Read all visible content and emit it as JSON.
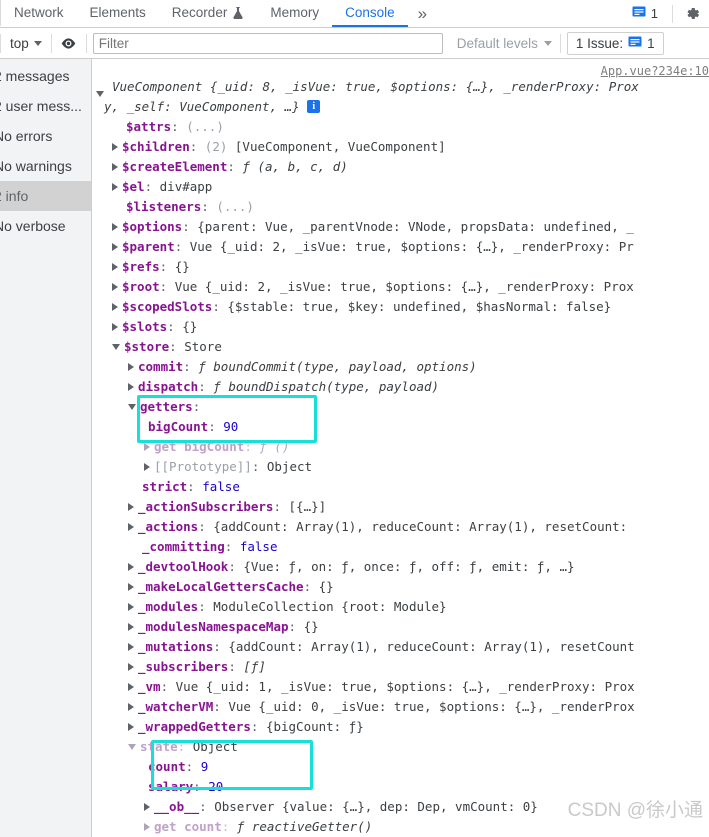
{
  "devtools": {
    "tabs": [
      {
        "label": "Network",
        "active": false,
        "icon": null
      },
      {
        "label": "Elements",
        "active": false,
        "icon": null
      },
      {
        "label": "Recorder",
        "active": false,
        "icon": "flask-icon"
      },
      {
        "label": "Memory",
        "active": false,
        "icon": null
      },
      {
        "label": "Console",
        "active": true,
        "icon": null
      }
    ],
    "more_label": "»",
    "message_badge_count": "1",
    "gear_icon": "gear-icon"
  },
  "toolbar": {
    "context": "top",
    "eye_icon": "eye-icon",
    "filter_placeholder": "Filter",
    "filter_value": "",
    "levels_label": "Default levels",
    "issues_label": "1 Issue:",
    "issues_count": "1"
  },
  "sidebar": {
    "items": [
      {
        "label": "2 messages",
        "selected": false
      },
      {
        "label": "2 user mess...",
        "selected": false
      },
      {
        "label": "No errors",
        "selected": false
      },
      {
        "label": "No warnings",
        "selected": false
      },
      {
        "label": "2 info",
        "selected": true
      },
      {
        "label": "No verbose",
        "selected": false
      }
    ]
  },
  "console": {
    "source_link": "App.vue?234e:10",
    "watermark": "CSDN @徐小通",
    "accent_highlight": "#17e0d8",
    "lines": {
      "root_a": "VueComponent {_uid: 8, _isVue: true, $options: {…}, _renderProxy: Prox",
      "root_b": "y, _self: VueComponent, …}",
      "attrs_k": "$attrs",
      "attrs_v": "(...)",
      "children_k": "$children",
      "children_count": "(2)",
      "children_v": "[VueComponent, VueComponent]",
      "createElement_k": "$createElement",
      "createElement_v": "ƒ (a, b, c, d)",
      "el_k": "$el",
      "el_v": "div#app",
      "listeners_k": "$listeners",
      "listeners_v": "(...)",
      "options_k": "$options",
      "options_v": "{parent: Vue, _parentVnode: VNode, propsData: undefined, _",
      "parent_k": "$parent",
      "parent_v": "Vue {_uid: 2, _isVue: true, $options: {…}, _renderProxy: Pr",
      "refs_k": "$refs",
      "refs_v": "{}",
      "rootprop_k": "$root",
      "rootprop_v": "Vue {_uid: 2, _isVue: true, $options: {…}, _renderProxy: Prox",
      "scopedSlots_k": "$scopedSlots",
      "scopedSlots_v": "{$stable: true, $key: undefined, $hasNormal: false}",
      "slots_k": "$slots",
      "slots_v": "{}",
      "store_k": "$store",
      "store_v": "Store",
      "commit_k": "commit",
      "commit_v": "ƒ boundCommit(type, payload, options)",
      "dispatch_k": "dispatch",
      "dispatch_v": "ƒ boundDispatch(type, payload)",
      "getters_k": "getters",
      "getters_v": "",
      "bigCount_k": "bigCount",
      "bigCount_v": "90",
      "getBigCount_k": "get bigCount",
      "getBigCount_v": "ƒ ()",
      "prototype_k": "[[Prototype]]",
      "prototype_v": "Object",
      "strict_k": "strict",
      "strict_v": "false",
      "actionSubscribers_k": "_actionSubscribers",
      "actionSubscribers_v": "[{…}]",
      "actions_k": "_actions",
      "actions_v": "{addCount: Array(1), reduceCount: Array(1), resetCount:",
      "committing_k": "_committing",
      "committing_v": "false",
      "devtoolHook_k": "_devtoolHook",
      "devtoolHook_v": "{Vue: ƒ, on: ƒ, once: ƒ, off: ƒ, emit: ƒ, …}",
      "makeLocalGettersCache_k": "_makeLocalGettersCache",
      "makeLocalGettersCache_v": "{}",
      "modules_k": "_modules",
      "modules_v": "ModuleCollection {root: Module}",
      "modulesNamespaceMap_k": "_modulesNamespaceMap",
      "modulesNamespaceMap_v": "{}",
      "mutations_k": "_mutations",
      "mutations_v": "{addCount: Array(1), reduceCount: Array(1), resetCount",
      "subscribers_k": "_subscribers",
      "subscribers_v": "[ƒ]",
      "vm_k": "_vm",
      "vm_v": "Vue {_uid: 1, _isVue: true, $options: {…}, _renderProxy: Prox",
      "watcherVM_k": "_watcherVM",
      "watcherVM_v": "Vue {_uid: 0, _isVue: true, $options: {…}, _renderProx",
      "wrappedGetters_k": "_wrappedGetters",
      "wrappedGetters_v": "{bigCount: ƒ}",
      "state_k": "state",
      "state_v": "Object",
      "count_k": "count",
      "count_v": "9",
      "salary_k": "salary",
      "salary_v": "20",
      "ob_k": "__ob__",
      "ob_v": "Observer {value: {…}, dep: Dep, vmCount: 0}",
      "getCount_k": "get count",
      "getCount_v": "ƒ reactiveGetter()"
    }
  }
}
